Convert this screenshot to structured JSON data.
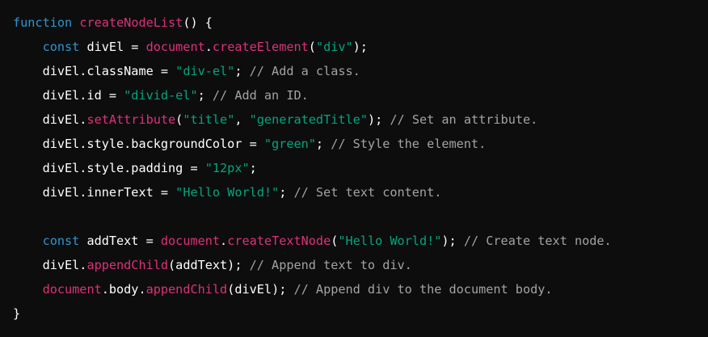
{
  "code": {
    "lines": [
      [
        [
          "kw",
          "function"
        ],
        [
          "id",
          " "
        ],
        [
          "obj",
          "createNodeList"
        ],
        [
          "id",
          "() {"
        ]
      ],
      [
        [
          "id",
          "    "
        ],
        [
          "kw",
          "const"
        ],
        [
          "id",
          " divEl = "
        ],
        [
          "obj",
          "document"
        ],
        [
          "id",
          "."
        ],
        [
          "obj",
          "createElement"
        ],
        [
          "id",
          "("
        ],
        [
          "str",
          "\"div\""
        ],
        [
          "id",
          ");"
        ]
      ],
      [
        [
          "id",
          "    divEl.className = "
        ],
        [
          "str",
          "\"div-el\""
        ],
        [
          "id",
          "; "
        ],
        [
          "com",
          "// Add a class."
        ]
      ],
      [
        [
          "id",
          "    divEl.id = "
        ],
        [
          "str",
          "\"divid-el\""
        ],
        [
          "id",
          "; "
        ],
        [
          "com",
          "// Add an ID."
        ]
      ],
      [
        [
          "id",
          "    divEl."
        ],
        [
          "obj",
          "setAttribute"
        ],
        [
          "id",
          "("
        ],
        [
          "str",
          "\"title\""
        ],
        [
          "id",
          ", "
        ],
        [
          "str",
          "\"generatedTitle\""
        ],
        [
          "id",
          "); "
        ],
        [
          "com",
          "// Set an attribute."
        ]
      ],
      [
        [
          "id",
          "    divEl.style.backgroundColor = "
        ],
        [
          "str",
          "\"green\""
        ],
        [
          "id",
          "; "
        ],
        [
          "com",
          "// Style the element."
        ]
      ],
      [
        [
          "id",
          "    divEl.style.padding = "
        ],
        [
          "str",
          "\"12px\""
        ],
        [
          "id",
          ";"
        ]
      ],
      [
        [
          "id",
          "    divEl.innerText = "
        ],
        [
          "str",
          "\"Hello World!\""
        ],
        [
          "id",
          "; "
        ],
        [
          "com",
          "// Set text content."
        ]
      ],
      [],
      [
        [
          "id",
          "    "
        ],
        [
          "kw",
          "const"
        ],
        [
          "id",
          " addText = "
        ],
        [
          "obj",
          "document"
        ],
        [
          "id",
          "."
        ],
        [
          "obj",
          "createTextNode"
        ],
        [
          "id",
          "("
        ],
        [
          "str",
          "\"Hello World!\""
        ],
        [
          "id",
          "); "
        ],
        [
          "com",
          "// Create text node."
        ]
      ],
      [
        [
          "id",
          "    divEl."
        ],
        [
          "obj",
          "appendChild"
        ],
        [
          "id",
          "(addText); "
        ],
        [
          "com",
          "// Append text to div."
        ]
      ],
      [
        [
          "id",
          "    "
        ],
        [
          "obj",
          "document"
        ],
        [
          "id",
          ".body."
        ],
        [
          "obj",
          "appendChild"
        ],
        [
          "id",
          "(divEl); "
        ],
        [
          "com",
          "// Append div to the document body."
        ]
      ],
      [
        [
          "id",
          "}"
        ]
      ]
    ],
    "colors": {
      "background": "#0d0d0d",
      "keyword": "#2e95d3",
      "identifier": "#ffffff",
      "function_object": "#df3079",
      "string": "#00a67d",
      "comment": "#a3a3a3"
    }
  }
}
